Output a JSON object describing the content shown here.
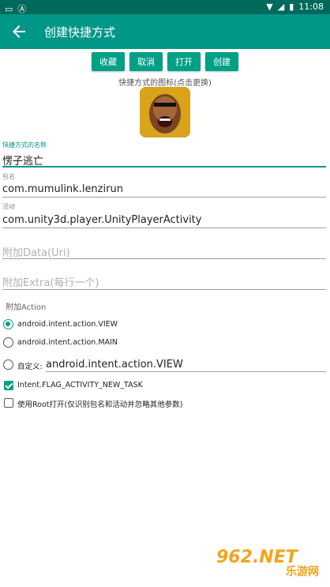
{
  "status": {
    "time": "11:08"
  },
  "appbar": {
    "title": "创建快捷方式"
  },
  "buttons": {
    "collect": "收藏",
    "cancel": "取消",
    "open": "打开",
    "create": "创建"
  },
  "icon_hint": "快捷方式的图标(点击更换)",
  "shortcut_name": {
    "label": "快捷方式的名称",
    "value": "愣子逃亡"
  },
  "package": {
    "label": "包名",
    "value": "com.mumulink.lenzirun"
  },
  "activity": {
    "label": "活动",
    "value": "com.unity3d.player.UnityPlayerActivity"
  },
  "data_uri": {
    "placeholder": "附加Data(Uri)"
  },
  "extra": {
    "placeholder": "附加Extra(每行一个)"
  },
  "action_section": "附加Action",
  "actions": {
    "view": "android.intent.action.VIEW",
    "main": "android.intent.action.MAIN",
    "custom_label": "自定义:",
    "custom_value": "android.intent.action.VIEW"
  },
  "flags": {
    "new_task": "Intent.FLAG_ACTIVITY_NEW_TASK",
    "root": "使用Root打开(仅识别包名和活动并忽略其他参数)"
  },
  "watermark": {
    "num": "962.NET",
    "cn": "乐游网"
  },
  "colors": {
    "accent": "#009688",
    "accent_dark": "#00695c",
    "button": "#00a087"
  }
}
